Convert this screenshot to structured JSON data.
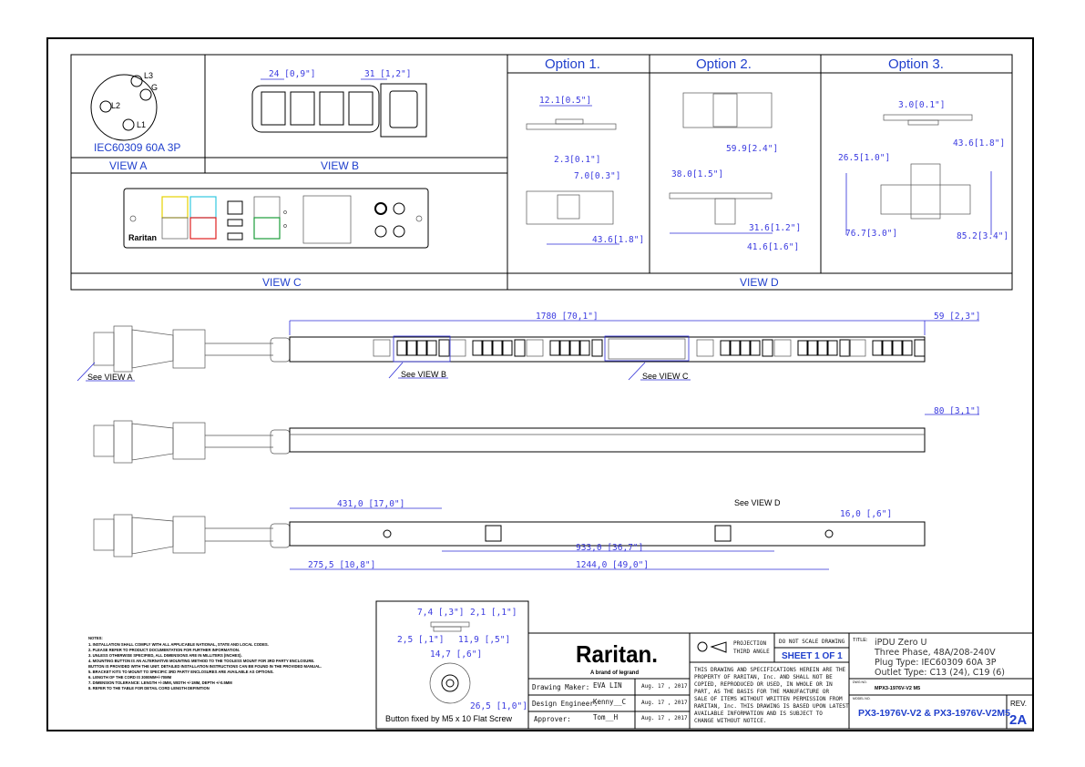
{
  "colors": {
    "accent": "#1f3fcc",
    "line": "#000000",
    "dimension": "#3a3ae0",
    "brand_red": "#d0021b"
  },
  "views": {
    "view_a": {
      "label": "VIEW A",
      "plug_caption": "IEC60309 60A 3P",
      "pins": [
        "L3",
        "G",
        "L2",
        "L1"
      ]
    },
    "view_b": {
      "label": "VIEW B",
      "dim_c13": "24 [0,9\"]",
      "dim_c19": "31 [1,2\"]"
    },
    "view_c": {
      "label": "VIEW C",
      "port_labels": [
        "SENSOR",
        "CONSOLE / MODEM",
        "USB-B",
        "ETH 1/100",
        "EXPANSION",
        "FEATURE",
        "USB-A",
        "ETH 2/100",
        "RESET"
      ],
      "brand": "Raritan"
    },
    "view_d": {
      "label": "VIEW D"
    }
  },
  "options": [
    {
      "title": "Option 1.",
      "dims": [
        "12.1[0.5\"]",
        "2.3[0.1\"]",
        "7.0[0.3\"]",
        "43.6[1.8\"]"
      ]
    },
    {
      "title": "Option  2.",
      "dims": [
        "59.9[2.4\"]",
        "38.0[1.5\"]",
        "31.6[1.2\"]",
        "41.6[1.6\"]"
      ]
    },
    {
      "title": "Option 3.",
      "dims": [
        "3.0[0.1\"]",
        "43.6[1.8\"]",
        "26.5[1.0\"]",
        "76.7[3.0\"]",
        "85.2[3.4\"]"
      ]
    }
  ],
  "front_view": {
    "length": "1780 [70,1\"]",
    "width": "59 [2,3\"]",
    "callouts": [
      "See VIEW A",
      "See VIEW B",
      "See VIEW C"
    ]
  },
  "side_view": {
    "depth": "80 [3,1\"]"
  },
  "back_view": {
    "callout": "See VIEW D",
    "dims": [
      "431,0 [17,0\"]",
      "16,0 [,6\"]",
      "933,0 [36,7\"]",
      "275,5 [10,8\"]",
      "1244,0 [49,0\"]"
    ]
  },
  "button_detail": {
    "dims": [
      "7,4 [,3\"]",
      "2,1 [,1\"]",
      "2,5 [,1\"]",
      "11,9 [,5\"]",
      "14,7 [,6\"]",
      "26,5 [1,0\"]"
    ],
    "caption": "Button fixed by M5 x 10 Flat Screw"
  },
  "notes": {
    "heading": "NOTES:",
    "items": [
      "1. INSTALLATION SHALL COMPLY WITH ALL APPLICABLE NATIONAL, STATE AND LOCAL CODES.",
      "2. PLEASE REFER TO PRODUCT DOCUMENTATION FOR FURTHER INFORMATION.",
      "3. UNLESS OTHERWISE SPECIFIED, ALL DIMENSIONS ARE IN MILLITERS (INCHES).",
      "4. MOUNTING BUTTON IS AN ALTERNATIVE MOUNTING METHOD TO THE TOOLESS MOUNT FOR 3RD PARTY ENCLOSURE.",
      "    BUTTON IS PROVIDED WITH THE UNIT. DETAILED INSTALLATION INSTRUCTIONS CAN BE FOUND IN THE PROVIDED MANUAL.",
      "5. BRACKET KITS TO MOUNT TO SPECIFIC 3RD PARTY ENCLOSURES ARE AVAILABLE AS OPTIONS.",
      "6. LENGTH OF THE CORD IS 3000MM+/-70MM",
      "7. DIMENSION TOLERANCE: LENGTH +/-3MM, WIDTH +/-1MM, DEPTH +/-0.5MM",
      "8. REFER TO THE TABLE FOR DETAIL CORD LENGTH DEFINITION"
    ]
  },
  "title_block": {
    "logo": "Raritan.",
    "tagline": "A brand of legrand",
    "rows": [
      {
        "role": "Drawing Maker:",
        "name": "EVA LIN",
        "date": "Aug. 17 , 2017"
      },
      {
        "role": "Design Engineer:",
        "name": "Kenny__C",
        "date": "Aug. 17 , 2017"
      },
      {
        "role": "Approver:",
        "name": "Tom__H",
        "date": "Aug. 17 , 2017"
      }
    ],
    "projection": [
      "PROJECTION",
      "THIRD ANGLE"
    ],
    "do_not_scale": "DO NOT SCALE DRAWING",
    "sheet": "SHEET 1 OF 1",
    "disclaimer": [
      "THIS DRAWING AND SPECIFICATIONS HEREIN ARE THE",
      "PROPERTY OF RARITAN, Inc. AND SHALL NOT BE",
      "COPIED, REPRODUCED OR USED, IN WHOLE OR IN",
      "PART, AS THE BASIS FOR THE MANUFACTURE OR",
      "SALE OF ITEMS WITHOUT WRITTEN PERMISSION FROM",
      "RARITAN, Inc. THIS DRAWING IS BASED UPON LATEST",
      "AVAILABLE INFORMATION AND IS SUBJECT TO",
      "CHANGE WITHOUT NOTICE."
    ],
    "title_label": "TITLE:",
    "title_lines": [
      "iPDU Zero U",
      "Three Phase, 48A/208-240V",
      "Plug Type: IEC60309 60A 3P",
      "Outlet Type: C13 (24), C19 (6)"
    ],
    "dwg_label": "DWG NO.",
    "dwg_no": "MPX3-1976V-V2 M5",
    "model_label": "MODEL NO.",
    "model_no": "PX3-1976V-V2 & PX3-1976V-V2M5",
    "rev_label": "REV.",
    "rev": "2A"
  }
}
